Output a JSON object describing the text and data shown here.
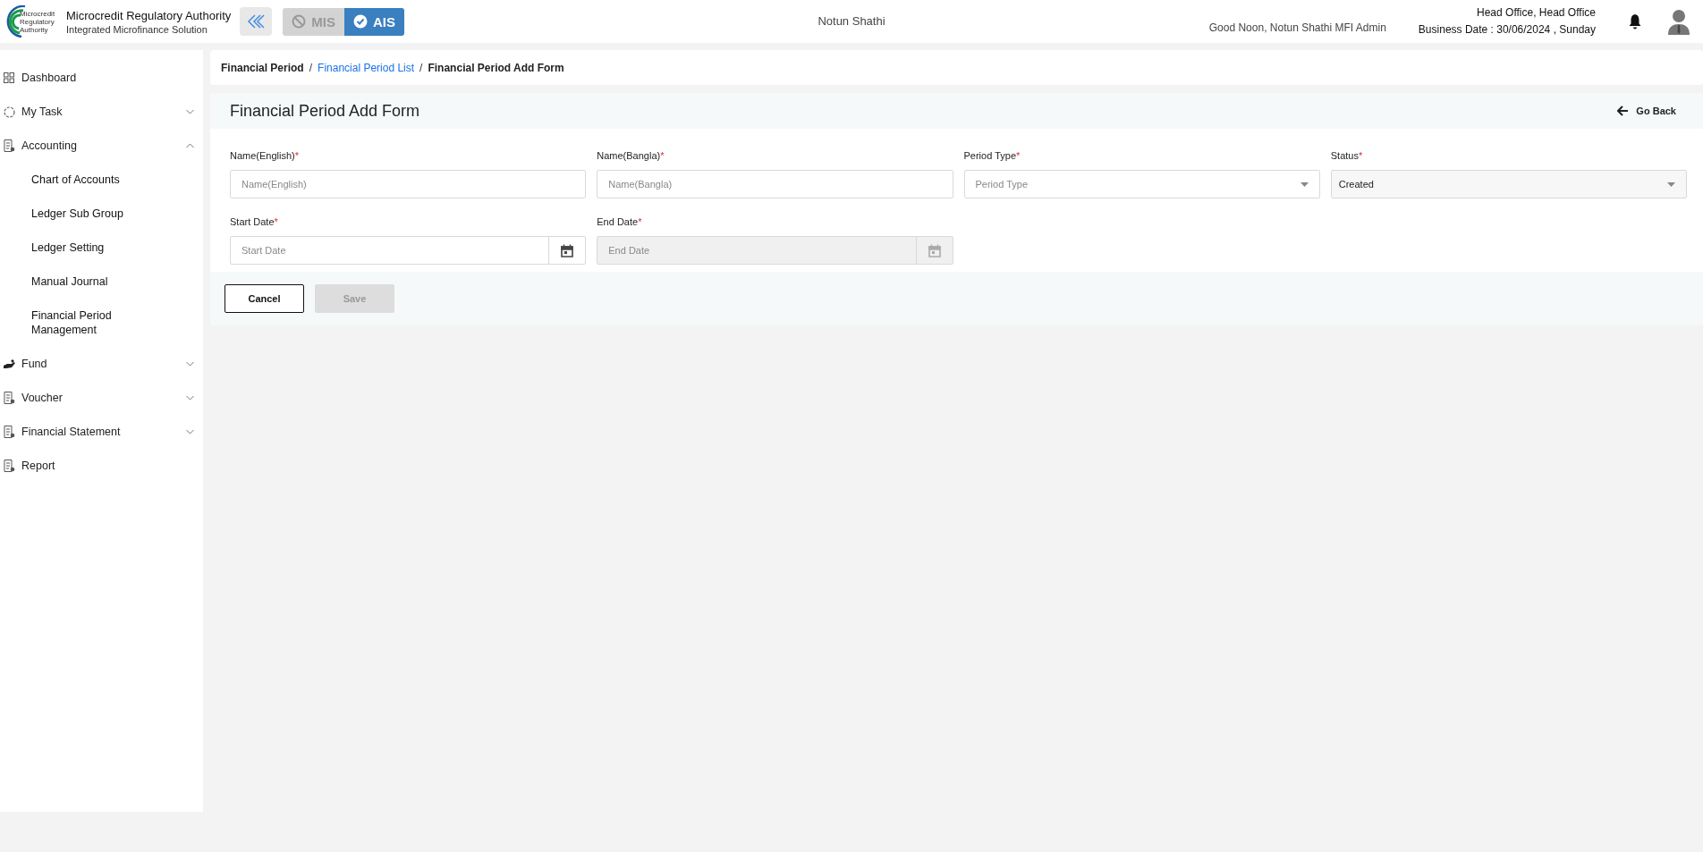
{
  "header": {
    "logo_text": [
      "Microcredit",
      "Regulatory",
      "Authority"
    ],
    "org_name": "Microcredit Regulatory Authority",
    "org_subtitle": "Integrated Microfinance Solution",
    "modules": [
      {
        "label": "MIS",
        "selected": false
      },
      {
        "label": "AIS",
        "selected": true
      }
    ],
    "center_title": "Notun Shathi",
    "greeting": "Good Noon, Notun Shathi MFI Admin",
    "office": "Head Office, Head Office",
    "business_date": "Business Date : 30/06/2024 , Sunday"
  },
  "sidebar": {
    "items": [
      {
        "label": "Dashboard",
        "kind": "grid"
      },
      {
        "label": "My Task",
        "kind": "task",
        "expanded": false
      },
      {
        "label": "Accounting",
        "kind": "document",
        "expanded": true,
        "children": [
          {
            "label": "Chart of Accounts"
          },
          {
            "label": "Ledger Sub Group"
          },
          {
            "label": "Ledger Setting"
          },
          {
            "label": "Manual Journal"
          },
          {
            "label": "Financial Period Management"
          }
        ]
      },
      {
        "label": "Fund",
        "kind": "fund",
        "expanded": false
      },
      {
        "label": "Voucher",
        "kind": "document",
        "expanded": false
      },
      {
        "label": "Financial Statement",
        "kind": "document",
        "expanded": false
      },
      {
        "label": "Report",
        "kind": "document"
      }
    ]
  },
  "breadcrumb": [
    {
      "label": "Financial Period",
      "kind": "text"
    },
    {
      "separator": "/",
      "label": "Financial Period List",
      "kind": "link"
    },
    {
      "separator": "/",
      "label": "Financial Period Add Form",
      "kind": "text"
    }
  ],
  "form": {
    "title": "Financial Period Add Form",
    "go_back": "Go Back",
    "fields": [
      {
        "label": "Name(English)",
        "required_mark": "*",
        "kind": "text",
        "placeholder": "Name(English)",
        "disabled": false
      },
      {
        "label": "Name(Bangla)",
        "required_mark": "*",
        "kind": "text",
        "placeholder": "Name(Bangla)",
        "disabled": false
      },
      {
        "label": "Period Type",
        "required_mark": "*",
        "kind": "select",
        "placeholder": "Period Type",
        "disabled": false
      },
      {
        "label": "Status",
        "required_mark": "*",
        "kind": "select",
        "value": "Created",
        "disabled": true
      },
      {
        "label": "Start Date",
        "required_mark": "*",
        "kind": "date",
        "placeholder": "Start Date",
        "disabled": false
      },
      {
        "label": "End Date",
        "required_mark": "*",
        "kind": "date",
        "placeholder": "End Date",
        "disabled": true
      }
    ],
    "buttons": [
      {
        "label": "Cancel",
        "disabled": false
      },
      {
        "label": "Save",
        "disabled": true
      }
    ]
  }
}
